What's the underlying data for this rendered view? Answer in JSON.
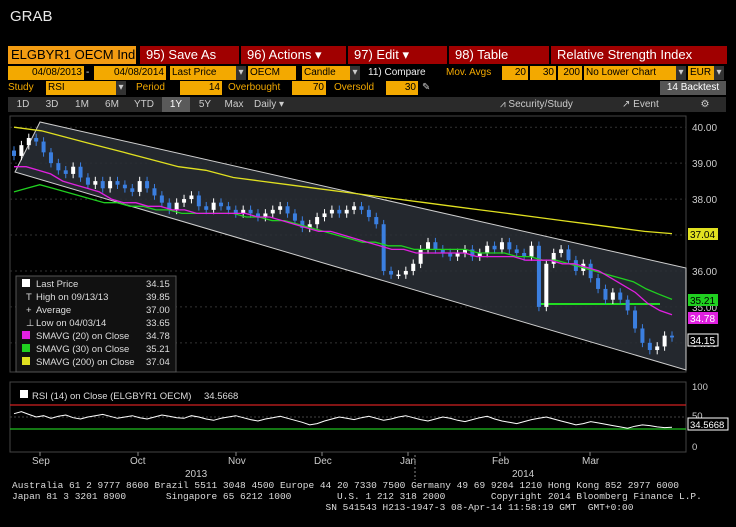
{
  "window": {
    "title": "GRAB"
  },
  "toolbar": {
    "ticker": "ELGBYR1 OECM Ind",
    "save": "95) Save As",
    "actions": "96) Actions",
    "edit": "97) Edit",
    "table": "98) Table",
    "study_title": "Relative Strength Index"
  },
  "settings": {
    "start_date": "04/08/2013",
    "end_date": "04/08/2014",
    "price_mode": "Last Price",
    "source": "OECM",
    "style": "Candle",
    "compare": "11) Compare",
    "mov_avgs_label": "Mov. Avgs",
    "mov_avg_1": "20",
    "mov_avg_2": "30",
    "mov_avg_3": "200",
    "lower_chart": "No Lower Chart",
    "currency": "EUR",
    "study_label": "Study",
    "study_value": "RSI",
    "period_label": "Period",
    "period_value": "14",
    "overbought_label": "Overbought",
    "overbought_value": "70",
    "oversold_label": "Oversold",
    "oversold_value": "30",
    "backtest": "14 Backtest"
  },
  "ranges": [
    "1D",
    "3D",
    "1M",
    "6M",
    "YTD",
    "1Y",
    "5Y",
    "Max"
  ],
  "range_selected": "1Y",
  "frequency": "Daily",
  "tools": {
    "security_study": "Security/Study",
    "event": "Event",
    "gear": "⚙"
  },
  "legend": {
    "last_price_label": "Last Price",
    "last_price": "34.15",
    "high_label": "High on 09/13/13",
    "high": "39.85",
    "average_label": "Average",
    "average": "37.00",
    "low_label": "Low on 04/03/14",
    "low": "33.65",
    "sma20_label": "SMAVG (20) on Close",
    "sma20": "34.78",
    "sma30_label": "SMAVG (30) on Close",
    "sma30": "35.21",
    "sma200_label": "SMAVG (200) on Close",
    "sma200": "37.04"
  },
  "rsi_legend": {
    "label": "RSI (14) on Close (ELGBYR1 OECM)",
    "value": "34.5668"
  },
  "colors": {
    "sma20": "#e020e0",
    "sma30": "#20d020",
    "sma200": "#e0e020",
    "candle_up": "#ffffff",
    "candle_down": "#3b7fe0",
    "accent": "#f3a900",
    "toolbar_red": "#a00000"
  },
  "chart_data": {
    "type": "line",
    "y_ticks": [
      "40.00",
      "39.00",
      "38.00",
      "37.00",
      "36.00",
      "35.00",
      "34.00"
    ],
    "ylim": [
      33.3,
      40.2
    ],
    "x_labels": [
      "Sep",
      "Oct",
      "Nov",
      "Dec",
      "Jan",
      "Feb",
      "Mar"
    ],
    "year_labels": [
      "2013",
      "2014"
    ],
    "price_tags": {
      "sma200": "37.04",
      "sma30": "35.21",
      "sma20": "34.78",
      "last": "34.15"
    },
    "close": [
      39.2,
      39.5,
      39.7,
      39.6,
      39.3,
      39.0,
      38.8,
      38.7,
      38.9,
      38.6,
      38.4,
      38.5,
      38.3,
      38.5,
      38.4,
      38.3,
      38.2,
      38.5,
      38.3,
      38.1,
      37.9,
      37.7,
      37.9,
      38.0,
      38.1,
      37.8,
      37.7,
      37.9,
      37.8,
      37.7,
      37.6,
      37.7,
      37.6,
      37.5,
      37.6,
      37.7,
      37.8,
      37.6,
      37.4,
      37.2,
      37.3,
      37.5,
      37.6,
      37.7,
      37.6,
      37.7,
      37.8,
      37.7,
      37.5,
      37.3,
      36.0,
      35.9,
      35.9,
      36.0,
      36.2,
      36.6,
      36.8,
      36.6,
      36.5,
      36.4,
      36.5,
      36.6,
      36.4,
      36.5,
      36.7,
      36.6,
      36.8,
      36.6,
      36.5,
      36.4,
      36.7,
      35.0,
      36.2,
      36.5,
      36.6,
      36.3,
      36.0,
      36.2,
      35.8,
      35.5,
      35.2,
      35.4,
      35.2,
      34.9,
      34.4,
      34.0,
      33.8,
      33.9,
      34.2,
      34.15
    ],
    "sma20": [
      38.9,
      38.9,
      38.8,
      38.7,
      38.5,
      38.4,
      38.3,
      38.2,
      38.0,
      37.9,
      37.9,
      37.8,
      37.8,
      37.7,
      37.7,
      37.6,
      37.6,
      37.6,
      37.6,
      37.6,
      37.5,
      37.5,
      37.4,
      37.3,
      37.2,
      37.1,
      37.1,
      37.0,
      36.9,
      36.8,
      36.7,
      36.6,
      36.6,
      36.5,
      36.5,
      36.5,
      36.5,
      36.5,
      36.4,
      36.4,
      36.4,
      36.4,
      36.3,
      36.3,
      36.3,
      36.2,
      36.2,
      36.1,
      36.0,
      35.8,
      35.6,
      35.4,
      35.1,
      34.9,
      34.78
    ],
    "sma30": [
      38.2,
      38.3,
      38.4,
      38.3,
      38.2,
      38.1,
      38.0,
      37.9,
      37.9,
      37.8,
      37.8,
      37.7,
      37.7,
      37.6,
      37.6,
      37.6,
      37.6,
      37.6,
      37.5,
      37.5,
      37.4,
      37.4,
      37.3,
      37.2,
      37.1,
      37.0,
      36.9,
      36.8,
      36.8,
      36.7,
      36.7,
      36.6,
      36.6,
      36.6,
      36.6,
      36.6,
      36.5,
      36.5,
      36.5,
      36.4,
      36.4,
      36.3,
      36.3,
      36.2,
      36.1,
      36.0,
      35.9,
      35.8,
      35.7,
      35.5,
      35.35,
      35.21
    ],
    "sma200": [
      40.0,
      39.9,
      39.7,
      39.5,
      39.3,
      39.1,
      38.9,
      38.8,
      38.6,
      38.5,
      38.4,
      38.3,
      38.2,
      38.1,
      38.0,
      37.9,
      37.8,
      37.7,
      37.6,
      37.5,
      37.4,
      37.3,
      37.2,
      37.1,
      37.04
    ],
    "rsi": [
      55,
      58,
      54,
      50,
      52,
      48,
      51,
      53,
      49,
      47,
      50,
      52,
      54,
      51,
      48,
      50,
      52,
      49,
      47,
      50,
      53,
      51,
      49,
      48,
      52,
      50,
      47,
      45,
      48,
      50,
      52,
      49,
      46,
      44,
      47,
      49,
      51,
      48,
      45,
      42,
      38,
      40,
      44,
      47,
      50,
      48,
      46,
      49,
      51,
      48,
      45,
      47,
      50,
      52,
      49,
      46,
      44,
      47,
      50,
      48,
      45,
      43,
      46,
      49,
      51,
      47,
      44,
      42,
      40,
      43,
      46,
      48,
      50,
      47,
      44,
      41,
      38,
      40,
      43,
      41,
      39,
      37,
      35,
      33,
      36,
      38,
      37,
      35,
      34,
      34.5668
    ],
    "rsi_ticks": [
      "100",
      "50",
      "0"
    ]
  },
  "footer": {
    "line1": "Australia 61 2 9777 8600 Brazil 5511 3048 4500 Europe 44 20 7330 7500 Germany 49 69 9204 1210 Hong Kong 852 2977 6000",
    "line2": "Japan 81 3 3201 8900       Singapore 65 6212 1000        U.S. 1 212 318 2000        Copyright 2014 Bloomberg Finance L.P.",
    "line3": "                                                       SN 541543 H213-1947-3 08-Apr-14 11:58:19 GMT  GMT+0:00"
  }
}
